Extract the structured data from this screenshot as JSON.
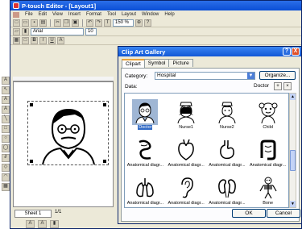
{
  "app": {
    "title": "P-touch Editor - [Layout1]"
  },
  "menu": [
    "File",
    "Edit",
    "View",
    "Insert",
    "Format",
    "Tool",
    "Layout",
    "Window",
    "Help"
  ],
  "toolbar": {
    "font": "Arial",
    "font_size": "10",
    "zoom": "150 %"
  },
  "sheet": {
    "tab": "Sheet 1",
    "page": "1/1"
  },
  "dialog": {
    "title": "Clip Art Gallery",
    "help": "?",
    "close": "X",
    "tabs": [
      "Clipart",
      "Symbol",
      "Picture"
    ],
    "category_label": "Category:",
    "category_value": "Hospital",
    "organize": "Organize...",
    "data_label": "Data:",
    "data_value": "Doctor",
    "ok": "OK",
    "cancel": "Cancel",
    "items": [
      {
        "label": "Doctor",
        "icon": "doctor-icon",
        "selected": true
      },
      {
        "label": "Nurse1",
        "icon": "nurse-icon"
      },
      {
        "label": "Nurse2",
        "icon": "nurse-icon"
      },
      {
        "label": "Child",
        "icon": "child-icon"
      },
      {
        "label": "Anatomical diagr...",
        "icon": "intestine-icon"
      },
      {
        "label": "Anatomical diagr...",
        "icon": "heart-icon"
      },
      {
        "label": "Anatomical diagr...",
        "icon": "stomach-icon"
      },
      {
        "label": "Anatomical diagr...",
        "icon": "colon-icon"
      },
      {
        "label": "Anatomical diagr...",
        "icon": "lungs-icon"
      },
      {
        "label": "Anatomical diagr...",
        "icon": "ear-icon"
      },
      {
        "label": "Anatomical diagr...",
        "icon": "kidney-icon"
      },
      {
        "label": "Bone",
        "icon": "skeleton-icon"
      }
    ]
  }
}
